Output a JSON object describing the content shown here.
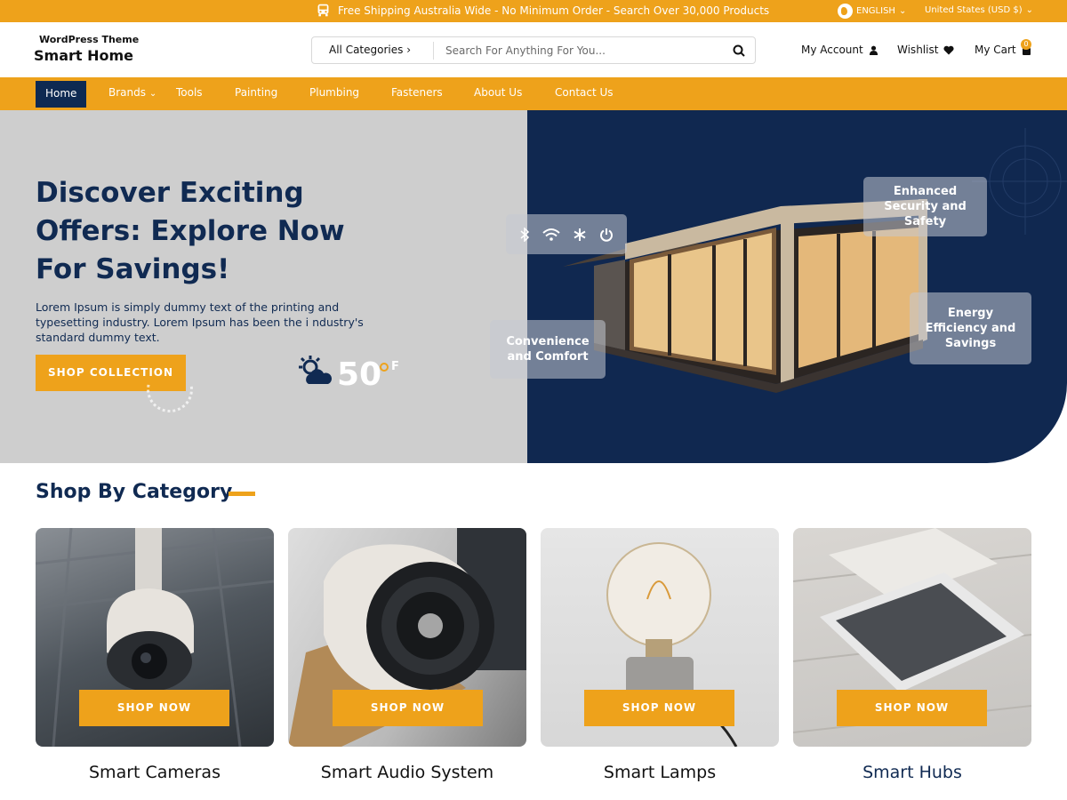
{
  "topbar": {
    "shipping": "Free Shipping Australia Wide - No Minimum Order - Search Over 30,000 Products",
    "language": "ENGLISH",
    "currency": "United States (USD $)"
  },
  "header": {
    "logo_top": "WordPress Theme",
    "logo_main": "Smart Home",
    "categories_label": "All Categories",
    "search_placeholder": "Search For Anything For You...",
    "account": "My Account",
    "wishlist": "Wishlist",
    "cart": "My Cart",
    "cart_count": "0"
  },
  "nav": {
    "items": [
      "Home",
      "Brands",
      "Tools",
      "Painting",
      "Plumbing",
      "Fasteners",
      "About Us",
      "Contact Us"
    ]
  },
  "hero": {
    "title": "Discover Exciting Offers: Explore Now For Savings!",
    "text": "Lorem Ipsum is simply dummy text of the printing and typesetting industry. Lorem Ipsum has been the i ndustry's standard dummy text.",
    "button": "SHOP COLLECTION",
    "temperature": "50",
    "temp_unit": "F",
    "feature_security": "Enhanced Security and Safety",
    "feature_convenience": "Convenience and Comfort",
    "feature_energy": "Energy Efficiency and Savings"
  },
  "section": {
    "title": "Shop By Category"
  },
  "categories": [
    {
      "label": "Smart Cameras",
      "button": "SHOP NOW"
    },
    {
      "label": "Smart Audio System",
      "button": "SHOP NOW"
    },
    {
      "label": "Smart Lamps",
      "button": "SHOP NOW"
    },
    {
      "label": "Smart Hubs",
      "button": "SHOP NOW"
    }
  ],
  "colors": {
    "accent": "#eea21b",
    "navy": "#102850",
    "hero_gray": "#cecece"
  },
  "icons": [
    "bus-icon",
    "globe-icon",
    "chevron-down-icon",
    "search-icon",
    "user-icon",
    "heart-icon",
    "cart-icon",
    "bluetooth-icon",
    "wifi-icon",
    "snowflake-icon",
    "power-icon",
    "weather-icon"
  ]
}
